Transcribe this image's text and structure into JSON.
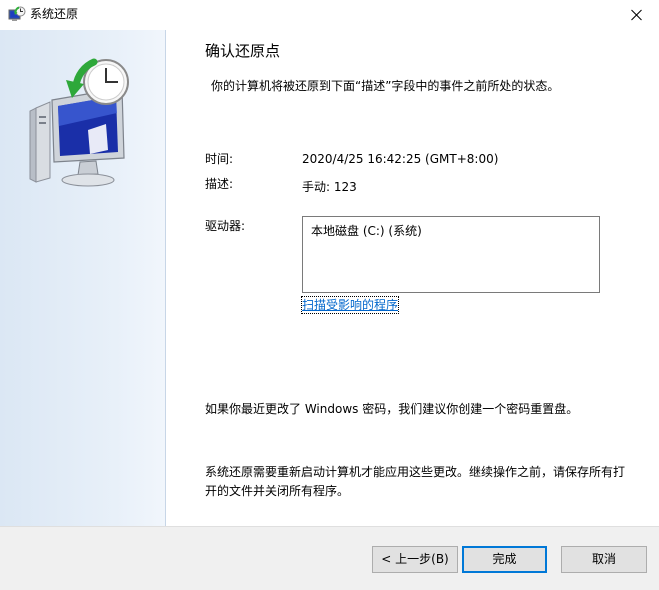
{
  "window": {
    "title": "系统还原",
    "close_glyph": "✕"
  },
  "page": {
    "title": "确认还原点",
    "description": "你的计算机将被还原到下面“描述”字段中的事件之前所处的状态。"
  },
  "fields": {
    "time_label": "时间:",
    "time_value": "2020/4/25 16:42:25 (GMT+8:00)",
    "desc_label": "描述:",
    "desc_value": "手动: 123",
    "drives_label": "驱动器:",
    "drives": [
      "本地磁盘 (C:) (系统)"
    ]
  },
  "links": {
    "scan_affected": "扫描受影响的程序"
  },
  "notes": {
    "password": "如果你最近更改了 Windows 密码，我们建议你创建一个密码重置盘。",
    "restart": "系统还原需要重新启动计算机才能应用这些更改。继续操作之前，请保存所有打开的文件并关闭所有程序。"
  },
  "buttons": {
    "back": "< 上一步(B)",
    "finish": "完成",
    "cancel": "取消"
  },
  "icons": {
    "app": "system-restore-icon",
    "close": "close-icon",
    "side_art": "computer-restore-illustration"
  },
  "colors": {
    "accent": "#0078d7",
    "link": "#0066cc",
    "side_panel": "#dbe7f4",
    "footer": "#f0f0f0"
  }
}
